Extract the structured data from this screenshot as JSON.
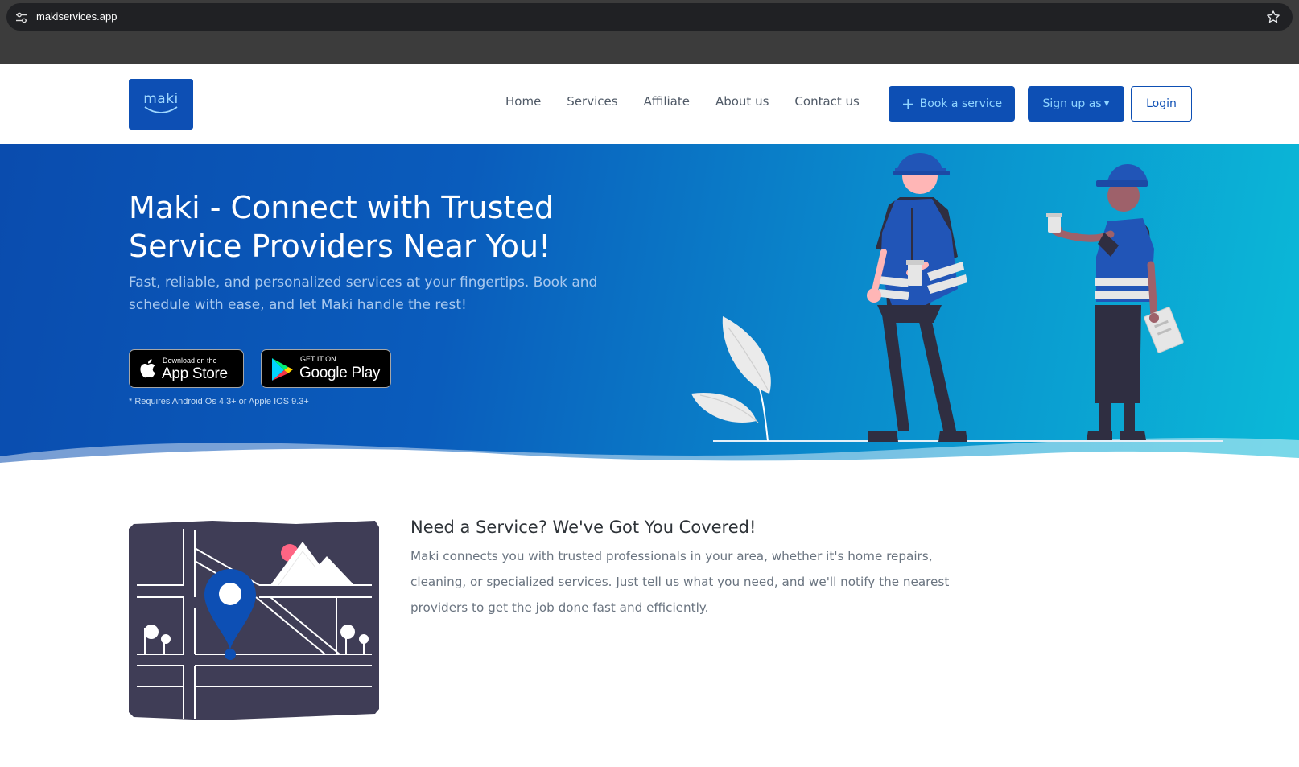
{
  "browser": {
    "url": "makiservices.app",
    "icons": {
      "site": "tune-icon",
      "bookmark": "star-icon"
    }
  },
  "navbar": {
    "logo_text": "maki",
    "links": [
      "Home",
      "Services",
      "Affiliate",
      "About us",
      "Contact us"
    ],
    "book_label": "Book a service",
    "signup_label": "Sign up as",
    "login_label": "Login"
  },
  "hero": {
    "title": "Maki - Connect with Trusted Service Providers Near You!",
    "subtitle": "Fast, reliable, and personalized services at your fingertips. Book and schedule with ease, and let Maki handle the rest!",
    "appstore": {
      "small": "Download on the",
      "big": "App Store"
    },
    "playstore": {
      "small": "GET IT ON",
      "big": "Google Play"
    },
    "requirements": "* Requires Android Os 4.3+ or Apple IOS 9.3+"
  },
  "feature": {
    "title": "Need a Service? We've Got You Covered!",
    "text": "Maki connects you with trusted professionals in your area, whether it's home repairs, cleaning, or specialized services. Just tell us what you need, and we'll notify the nearest providers to get the job done fast and efficiently."
  },
  "colors": {
    "brand_blue": "#0d4fb4",
    "button_text": "#8fd4ff",
    "hero_gradient_start": "#0a4cae",
    "hero_gradient_end": "#0bbad8",
    "map_dark": "#3f3d56"
  }
}
